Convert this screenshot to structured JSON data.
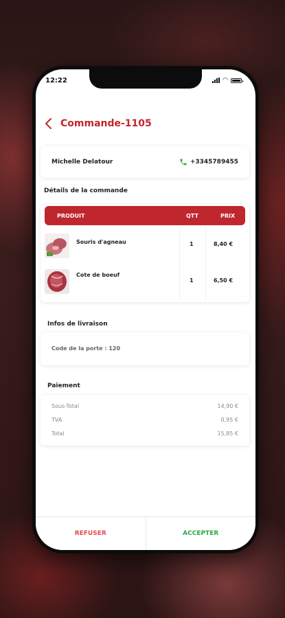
{
  "status_bar": {
    "time": "12:22"
  },
  "header": {
    "title": "Commande-1105"
  },
  "customer": {
    "name": "Michelle Delatour",
    "phone": "+3345789455"
  },
  "order": {
    "section_title": "Détails de la commande",
    "columns": {
      "product": "PRODUIT",
      "qty": "QTT",
      "price": "PRIX"
    },
    "items": [
      {
        "name": "Souris d'agneau",
        "qty": "1",
        "price": "8,40 €"
      },
      {
        "name": "Cote de boeuf",
        "qty": "1",
        "price": "6,50 €"
      }
    ]
  },
  "delivery": {
    "section_title": "Infos de livraison",
    "door_code": "Code de la porte : 120"
  },
  "payment": {
    "section_title": "Paiement",
    "rows": [
      {
        "label": "Sous-Total",
        "value": "14,90 €"
      },
      {
        "label": "TVA",
        "value": "0,95 €"
      },
      {
        "label": "Total",
        "value": "15,85 €"
      }
    ]
  },
  "footer": {
    "refuse_label": "REFUSER",
    "accept_label": "ACCEPTER"
  },
  "colors": {
    "brand_red": "#c0262d",
    "accept_green": "#27a844",
    "refuse_red": "#e34b50"
  }
}
